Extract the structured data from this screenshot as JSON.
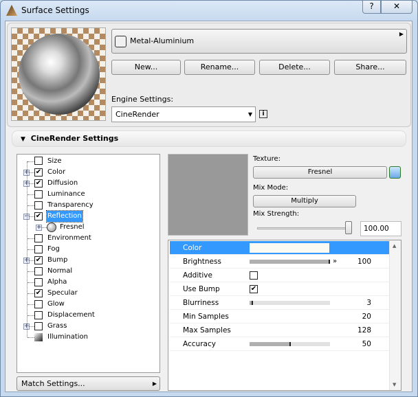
{
  "window": {
    "title": "Surface Settings",
    "help_label": "?",
    "close_label": "✕"
  },
  "material": {
    "name": "Metal-Aluminium"
  },
  "actions": {
    "new": "New...",
    "rename": "Rename...",
    "delete": "Delete...",
    "share": "Share..."
  },
  "engine": {
    "label": "Engine Settings:",
    "value": "CineRender",
    "info": "i"
  },
  "section": {
    "title": "CineRender Settings"
  },
  "tree": [
    {
      "label": "Size",
      "checked": null,
      "expander": null,
      "icon": "size"
    },
    {
      "label": "Color",
      "checked": true,
      "expander": "+"
    },
    {
      "label": "Diffusion",
      "checked": true,
      "expander": "+"
    },
    {
      "label": "Luminance",
      "checked": false,
      "expander": null
    },
    {
      "label": "Transparency",
      "checked": false,
      "expander": null
    },
    {
      "label": "Reflection",
      "checked": true,
      "expander": "-",
      "selected": true
    },
    {
      "label": "Fresnel",
      "checked": null,
      "expander": "+",
      "icon": "sphere",
      "child": true
    },
    {
      "label": "Environment",
      "checked": false,
      "expander": null
    },
    {
      "label": "Fog",
      "checked": false,
      "expander": null
    },
    {
      "label": "Bump",
      "checked": true,
      "expander": "+"
    },
    {
      "label": "Normal",
      "checked": false,
      "expander": null
    },
    {
      "label": "Alpha",
      "checked": false,
      "expander": null
    },
    {
      "label": "Specular",
      "checked": true,
      "expander": null
    },
    {
      "label": "Glow",
      "checked": false,
      "expander": null
    },
    {
      "label": "Displacement",
      "checked": false,
      "expander": null
    },
    {
      "label": "Grass",
      "checked": false,
      "expander": "+"
    },
    {
      "label": "Illumination",
      "checked": null,
      "expander": null,
      "icon": "illumination"
    }
  ],
  "match_settings": "Match Settings...",
  "texture": {
    "label": "Texture:",
    "value": "Fresnel"
  },
  "mix_mode": {
    "label": "Mix Mode:",
    "value": "Multiply"
  },
  "mix_strength": {
    "label": "Mix Strength:",
    "value": "100.00",
    "fraction": 1.0
  },
  "params": [
    {
      "label": "Color",
      "type": "color",
      "color": "#fbfaf2",
      "selected": true
    },
    {
      "label": "Brightness",
      "type": "slider",
      "fraction": 1.0,
      "value": "100"
    },
    {
      "label": "Additive",
      "type": "check",
      "checked": false
    },
    {
      "label": "Use Bump",
      "type": "check",
      "checked": true
    },
    {
      "label": "Blurriness",
      "type": "slider",
      "fraction": 0.03,
      "value": "3"
    },
    {
      "label": "Min Samples",
      "type": "number",
      "value": "20"
    },
    {
      "label": "Max Samples",
      "type": "number",
      "value": "128"
    },
    {
      "label": "Accuracy",
      "type": "slider",
      "fraction": 0.5,
      "value": "50"
    }
  ],
  "colors": {
    "selection": "#3399ff",
    "accent": "#4a90e2"
  }
}
